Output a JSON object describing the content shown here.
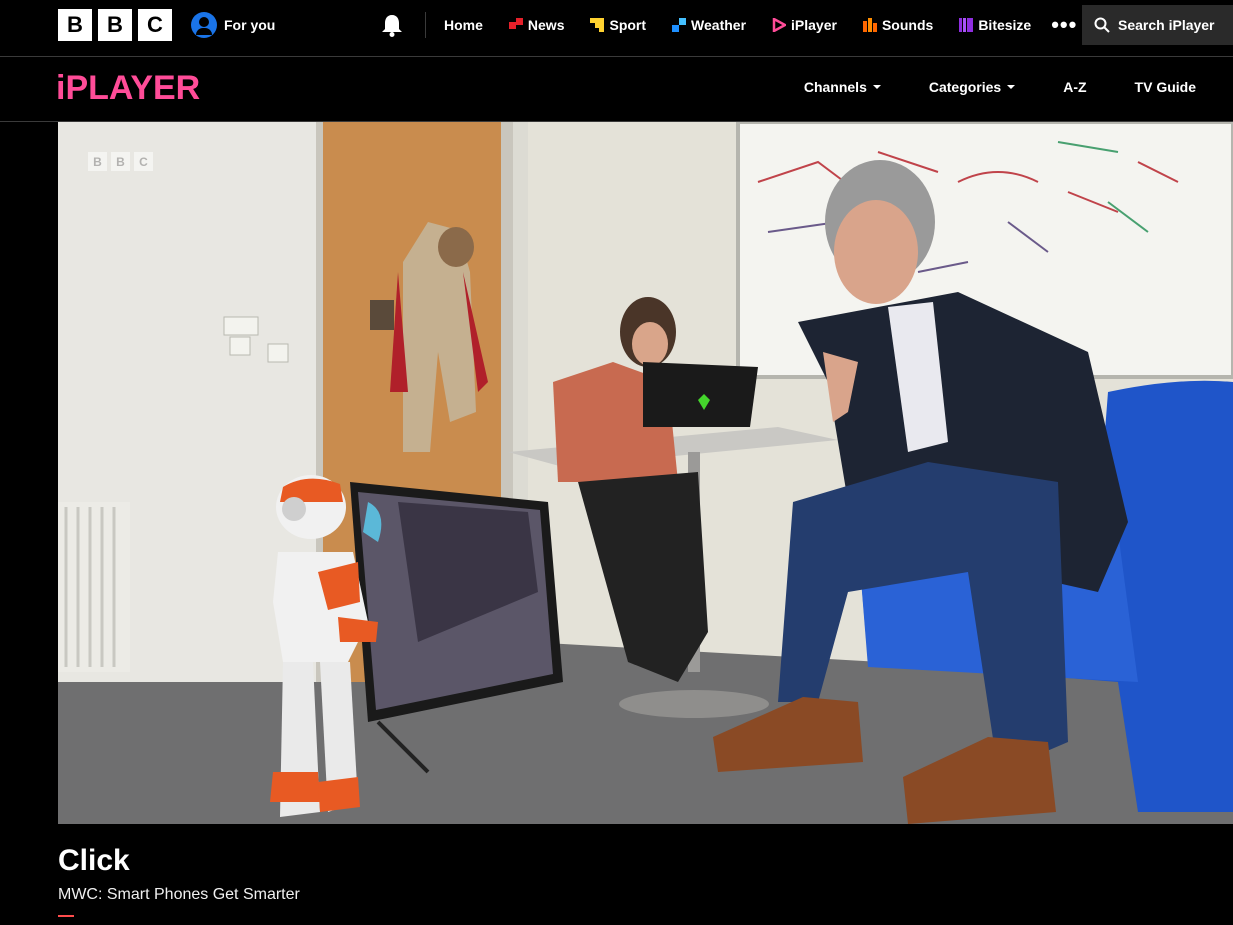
{
  "global_nav": {
    "logo_letters": [
      "B",
      "B",
      "C"
    ],
    "for_you": "For you",
    "links": [
      {
        "label": "Home",
        "icon": "",
        "color": ""
      },
      {
        "label": "News",
        "icon": "news-icon",
        "color": "#e5202a"
      },
      {
        "label": "Sport",
        "icon": "sport-icon",
        "color": "#ffd230"
      },
      {
        "label": "Weather",
        "icon": "weather-icon",
        "color": "#1e90ff"
      },
      {
        "label": "iPlayer",
        "icon": "iplayer-icon",
        "color": "#ff4c98"
      },
      {
        "label": "Sounds",
        "icon": "sounds-icon",
        "color": "#ff6600"
      },
      {
        "label": "Bitesize",
        "icon": "bitesize-icon",
        "color": "#8f2ee0"
      }
    ],
    "more": "•••",
    "search_label": "Search iPlayer"
  },
  "iplayer_nav": {
    "logo": "iPLAYER",
    "links": [
      {
        "label": "Channels",
        "dropdown": true
      },
      {
        "label": "Categories",
        "dropdown": true
      },
      {
        "label": "A-Z",
        "dropdown": false
      },
      {
        "label": "TV Guide",
        "dropdown": false
      }
    ]
  },
  "player": {
    "watermark_letters": [
      "B",
      "B",
      "C"
    ]
  },
  "programme": {
    "title": "Click",
    "episode": "MWC: Smart Phones Get Smarter"
  },
  "colors": {
    "iplayer_pink": "#ff4c98",
    "background": "#000000"
  }
}
